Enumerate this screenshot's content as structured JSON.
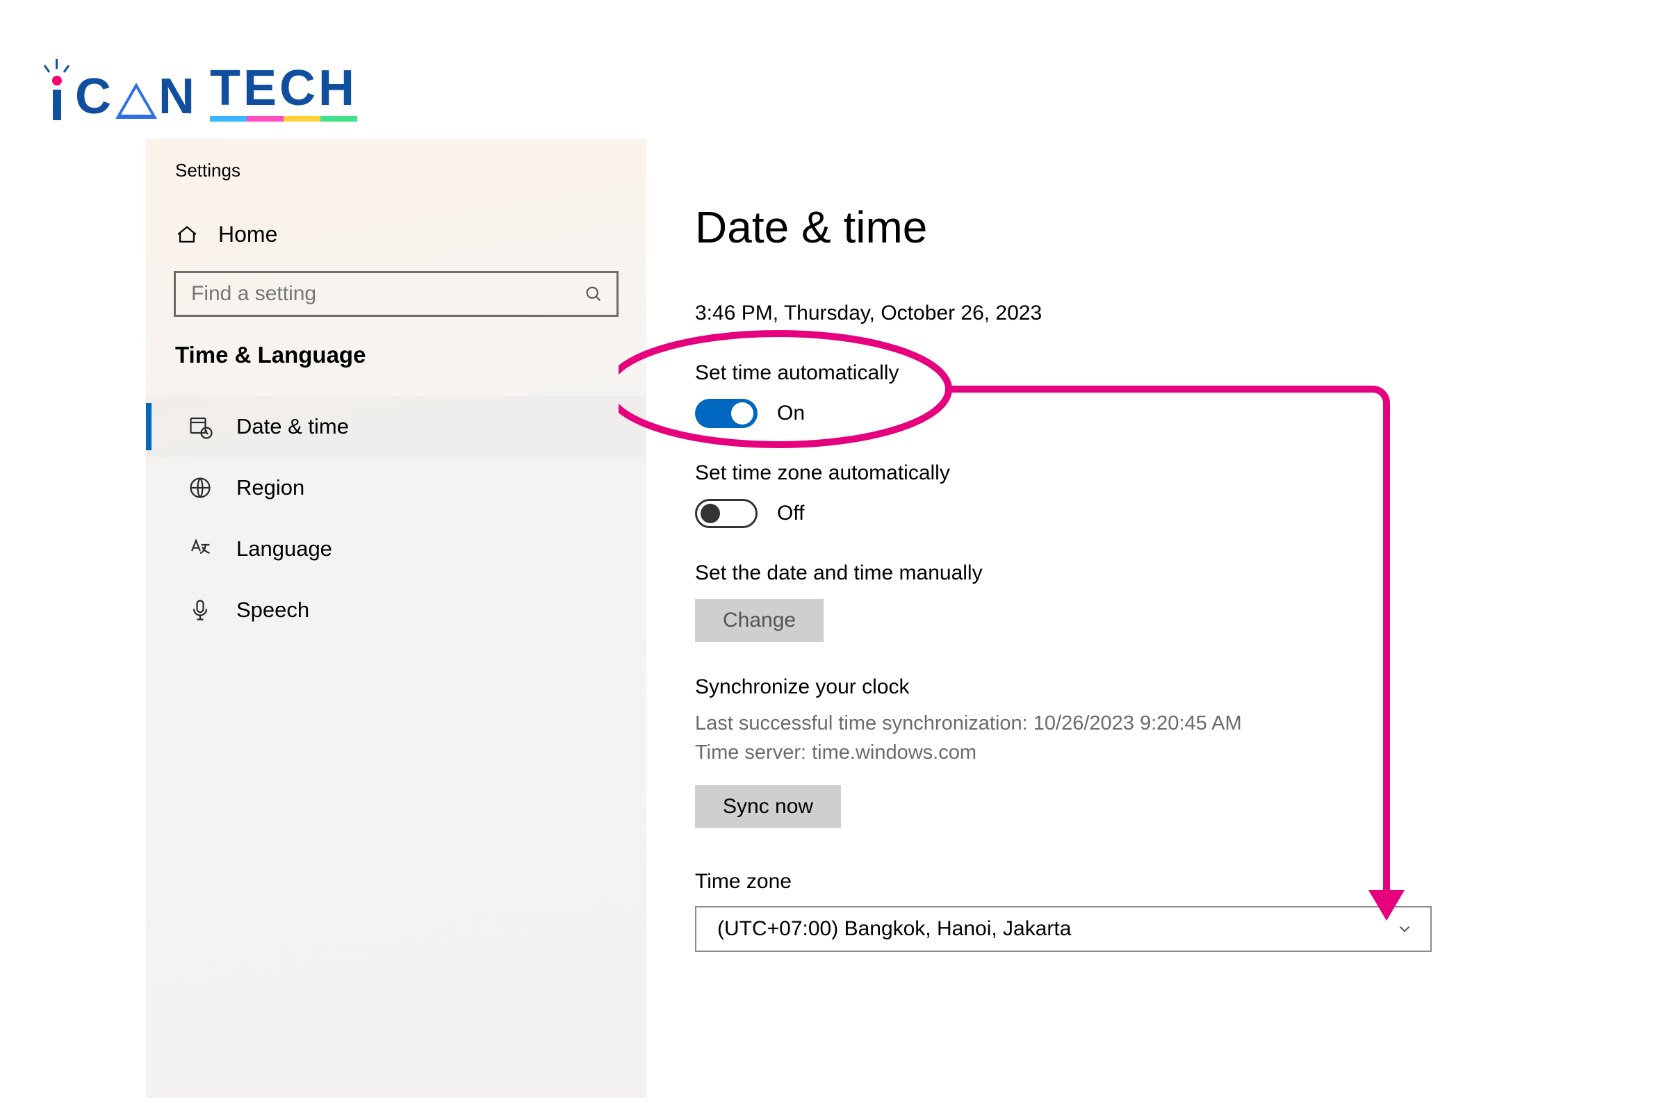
{
  "brand": {
    "word1": "C",
    "word2": "N",
    "tech": "TECH"
  },
  "sidebar": {
    "app_title": "Settings",
    "home_label": "Home",
    "search_placeholder": "Find a setting",
    "category": "Time & Language",
    "items": [
      {
        "label": "Date & time",
        "icon": "calendar-clock",
        "active": true
      },
      {
        "label": "Region",
        "icon": "globe",
        "active": false
      },
      {
        "label": "Language",
        "icon": "language",
        "active": false
      },
      {
        "label": "Speech",
        "icon": "microphone",
        "active": false
      }
    ]
  },
  "main": {
    "title": "Date & time",
    "current_datetime": "3:46 PM, Thursday, October 26, 2023",
    "set_time_auto": {
      "label": "Set time automatically",
      "state_label": "On",
      "on": true
    },
    "set_tz_auto": {
      "label": "Set time zone automatically",
      "state_label": "Off",
      "on": false
    },
    "manual": {
      "label": "Set the date and time manually",
      "button": "Change"
    },
    "sync": {
      "title": "Synchronize your clock",
      "last_sync": "Last successful time synchronization: 10/26/2023 9:20:45 AM",
      "server": "Time server: time.windows.com",
      "button": "Sync now"
    },
    "timezone": {
      "label": "Time zone",
      "selected": "(UTC+07:00) Bangkok, Hanoi, Jakarta"
    }
  },
  "annotation": {
    "color": "#e6007e"
  }
}
